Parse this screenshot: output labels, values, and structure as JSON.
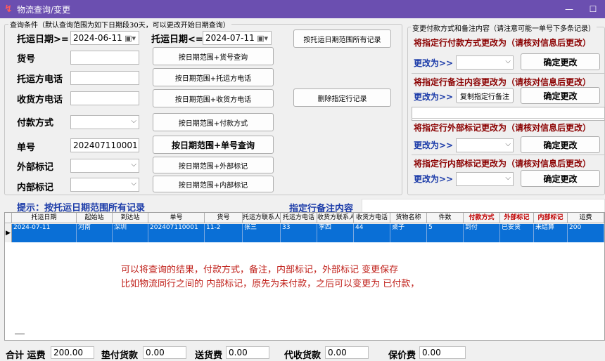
{
  "window": {
    "title": "物流查询/变更",
    "minimize": "—",
    "maximize": "☐"
  },
  "query": {
    "legend": "查询条件（默认查询范围为如下日期段30天，可以更改开始日期查询）",
    "date_from_label": "托运日期>=",
    "date_from": "2024-06-11",
    "date_to_label": "托运日期<=",
    "date_to": "2024-07-11",
    "all_by_date_btn": "按托运日期范围所有记录",
    "cargo_no_label": "货号",
    "cargo_no_value": "",
    "by_cargo_btn": "按日期范围+货号查询",
    "sender_phone_label": "托运方电话",
    "sender_phone_value": "",
    "by_sender_btn": "按日期范围+托运方电话",
    "receiver_phone_label": "收货方电话",
    "receiver_phone_value": "",
    "by_receiver_btn": "按日期范围+收货方电话",
    "delete_btn": "删除指定行记录",
    "payment_label": "付款方式",
    "payment_value": "",
    "by_payment_btn": "按日期范围+付款方式",
    "order_no_label": "单号",
    "order_no_value": "202407110001",
    "by_order_btn": "按日期范围+单号查询",
    "external_label": "外部标记",
    "external_value": "",
    "by_external_btn": "按日期范围+外部标记",
    "internal_label": "内部标记",
    "internal_value": "",
    "by_internal_btn": "按日期范围+内部标记"
  },
  "change": {
    "legend": "变更付款方式和备注内容（请注意可能一单号下多条记录）",
    "payment_title": "将指定行付款方式更改为（请核对信息后更改）",
    "change_to": "更改为>>",
    "confirm": "确定更改",
    "remark_title": "将指定行备注内容更改为（请核对信息后更改）",
    "copy_remark_btn": "复制指定行备注",
    "external_title": "将指定行外部标记更改为（请核对信息后更改）",
    "internal_title": "将指定行内部标记更改为（请核对信息后更改）"
  },
  "hint": "提示：按托运日期范围所有记录",
  "remark_label": "指定行备注内容",
  "grid": {
    "headers": [
      "托运日期",
      "起始站",
      "到达站",
      "单号",
      "货号",
      "托运方联系人",
      "托运方电话",
      "收货方联系人",
      "收货方电话",
      "货物名称",
      "件数",
      "付款方式",
      "外部标记",
      "内部标记",
      "运费"
    ],
    "row": [
      "2024-07-11",
      "河南",
      "深圳",
      "202407110001",
      "11-2",
      "张三",
      "33",
      "李四",
      "44",
      "桌子",
      "5",
      "到付",
      "已安货",
      "未结算",
      "200"
    ],
    "row_marker": "▶"
  },
  "notes": [
    "可以将查询的结果，付款方式，备注，内部标记，外部标记 变更保存",
    "比如物流同行之间的 内部标记，原先为未付款，之后可以变更为 已付款，"
  ],
  "footer": {
    "total_label": "合计 运费",
    "total_value": "200.00",
    "advance_label": "垫付货款",
    "advance_value": "0.00",
    "delivery_label": "送货费",
    "delivery_value": "0.00",
    "cod_label": "代收货款",
    "cod_value": "0.00",
    "insure_label": "保价费",
    "insure_value": "0.00"
  }
}
